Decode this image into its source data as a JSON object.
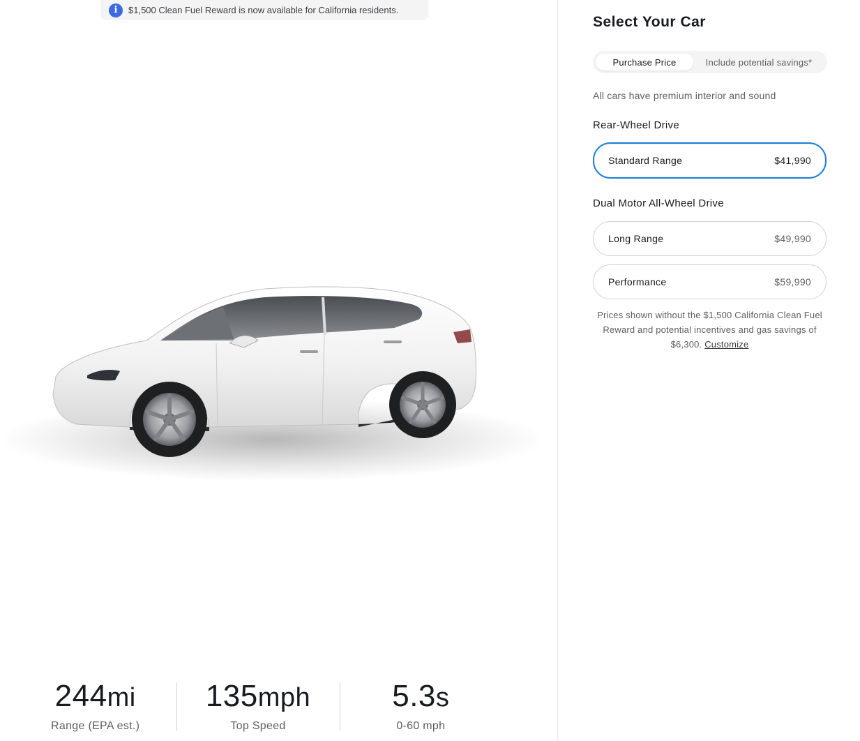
{
  "banner": {
    "icon": "info-icon",
    "text": "$1,500 Clean Fuel Reward is now available for California residents."
  },
  "specs": [
    {
      "value": "244",
      "unit": "mi",
      "label": "Range (EPA est.)"
    },
    {
      "value": "135",
      "unit": "mph",
      "label": "Top Speed"
    },
    {
      "value": "5.3",
      "unit": "s",
      "label": "0-60 mph"
    }
  ],
  "config": {
    "title": "Select Your Car",
    "toggle": {
      "options": [
        "Purchase Price",
        "Include potential savings*"
      ],
      "selected": "Purchase Price"
    },
    "note": "All cars have premium interior and sound",
    "groups": [
      {
        "title": "Rear-Wheel Drive",
        "options": [
          {
            "name": "Standard Range",
            "price": "$41,990",
            "selected": true
          }
        ]
      },
      {
        "title": "Dual Motor All-Wheel Drive",
        "options": [
          {
            "name": "Long Range",
            "price": "$49,990",
            "selected": false
          },
          {
            "name": "Performance",
            "price": "$59,990",
            "selected": false
          }
        ]
      }
    ],
    "disclaimer": {
      "text": "Prices shown without the $1,500 California Clean Fuel Reward and potential incentives and gas savings of $6,300.",
      "link": "Customize"
    }
  },
  "colors": {
    "accent": "#3e6ae1",
    "selected_border": "#1c7ed6",
    "text": "#171a20",
    "muted": "#5c5e62"
  }
}
